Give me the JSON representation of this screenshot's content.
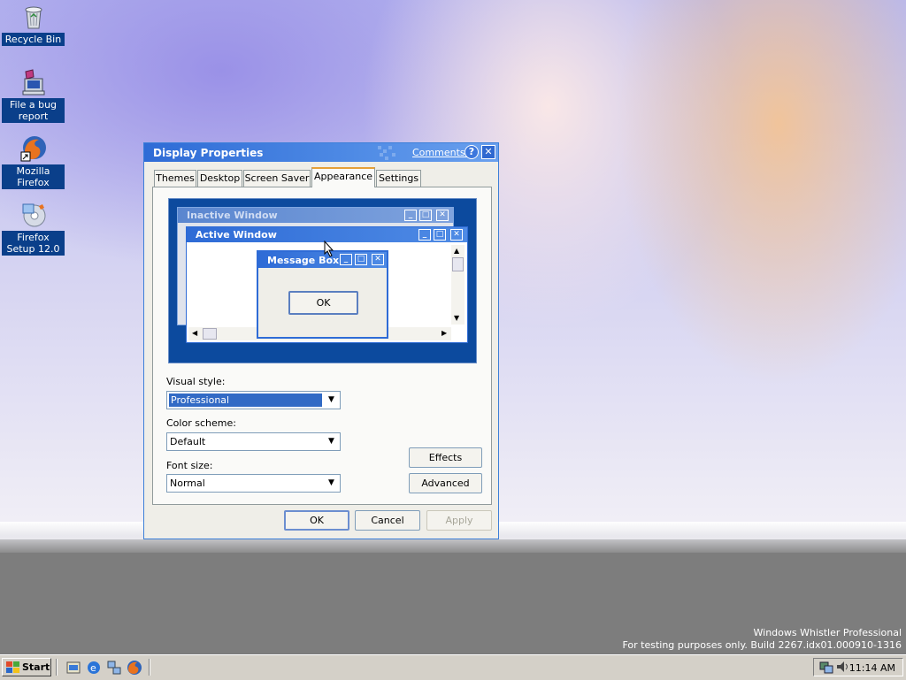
{
  "desktop": {
    "icons": [
      {
        "label": "Recycle Bin",
        "icon": "recycle-bin-icon"
      },
      {
        "label": "File a bug report",
        "icon": "bug-report-icon"
      },
      {
        "label": "Mozilla Firefox",
        "icon": "firefox-icon"
      },
      {
        "label": "Firefox Setup 12.0",
        "icon": "setup-cd-icon"
      }
    ],
    "watermark": {
      "line1": "Windows Whistler Professional",
      "line2": "For testing purposes only. Build 2267.idx01.000910-1316"
    }
  },
  "dialog": {
    "title": "Display Properties",
    "comments_link": "Comments?",
    "help_button": "?",
    "close_button": "✕",
    "tabs": [
      {
        "label": "Themes",
        "active": false
      },
      {
        "label": "Desktop",
        "active": false
      },
      {
        "label": "Screen Saver",
        "active": false
      },
      {
        "label": "Appearance",
        "active": true
      },
      {
        "label": "Settings",
        "active": false
      }
    ],
    "preview": {
      "inactive_title": "Inactive Window",
      "active_title": "Active Window",
      "message_title": "Message Box",
      "message_ok": "OK"
    },
    "visual_style": {
      "label": "Visual style:",
      "value": "Professional"
    },
    "color_scheme": {
      "label": "Color scheme:",
      "value": "Default"
    },
    "font_size": {
      "label": "Font size:",
      "value": "Normal"
    },
    "effects_button": "Effects",
    "advanced_button": "Advanced",
    "ok_button": "OK",
    "cancel_button": "Cancel",
    "apply_button": "Apply"
  },
  "taskbar": {
    "start_label": "Start",
    "quicklaunch": [
      "show-desktop-icon",
      "internet-explorer-icon",
      "network-icon",
      "firefox-icon"
    ],
    "clock": "11:14 AM"
  },
  "colors": {
    "title_bar": "#2e6bd6",
    "preview_bg": "#0c4a9e",
    "selection": "#316ac5",
    "desktop_label_bg": "#0a3f8a"
  }
}
